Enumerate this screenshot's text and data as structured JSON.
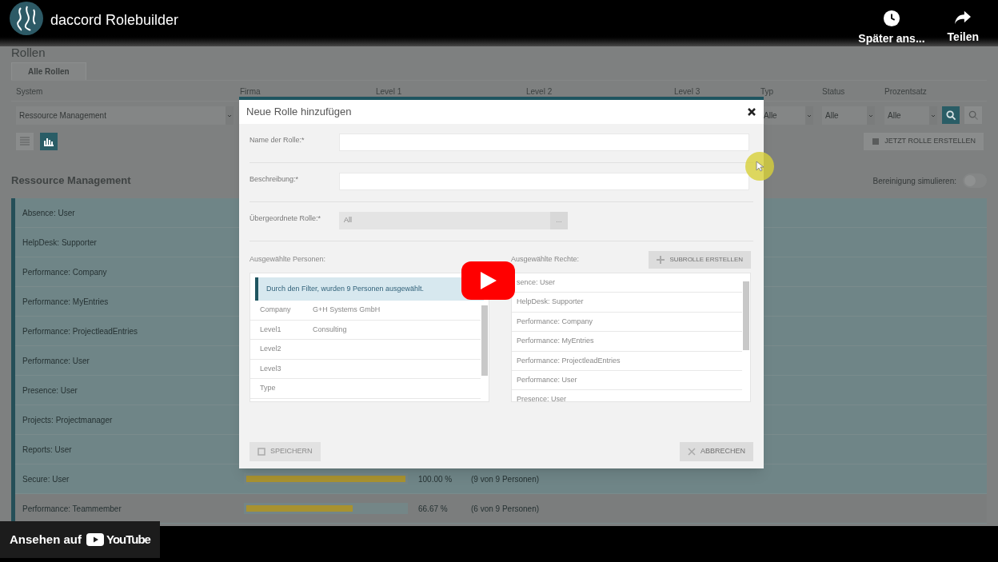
{
  "player": {
    "channel_title": "daccord Rolebuilder",
    "actions": [
      {
        "kind": "clock",
        "label": "Später ans..."
      },
      {
        "kind": "share",
        "label": "Teilen"
      }
    ],
    "watch_on": {
      "label": "Ansehen auf",
      "brand": "YouTube"
    }
  },
  "app": {
    "page_title": "Rollen",
    "tabs": [
      {
        "label": "Alle Rollen",
        "selected": true
      }
    ],
    "filters": [
      {
        "label": "System",
        "value": "Ressource Management"
      },
      {
        "label": "Firma"
      },
      {
        "label": "Level 1"
      },
      {
        "label": "Level 2"
      },
      {
        "label": "Level 3"
      },
      {
        "label": "Typ",
        "value": "Alle"
      },
      {
        "label": "Status",
        "value": "Alle"
      },
      {
        "label": "Prozentsatz",
        "value": "Alle"
      }
    ],
    "views": [
      {
        "kind": "list",
        "selected": false
      },
      {
        "kind": "chart",
        "selected": true
      }
    ],
    "create_button": "JETZT ROLLE ERSTELLEN",
    "section_title": "Ressource Management",
    "simulate": {
      "label": "Bereinigung simulieren:",
      "on": false
    },
    "roles": [
      {
        "name": "Absence: User",
        "highlighted": true
      },
      {
        "name": "HelpDesk: Supporter",
        "highlighted": true
      },
      {
        "name": "Performance: Company",
        "highlighted": true
      },
      {
        "name": "Performance: MyEntries",
        "highlighted": true
      },
      {
        "name": "Performance: ProjectleadEntries",
        "highlighted": true
      },
      {
        "name": "Performance: User",
        "highlighted": true
      },
      {
        "name": "Presence: User",
        "highlighted": true
      },
      {
        "name": "Projects: Projectmanager",
        "highlighted": true
      },
      {
        "name": "Reports: User",
        "highlighted": true
      },
      {
        "name": "Secure: User",
        "highlighted": true,
        "level": 1,
        "percent": "100.00 %",
        "count": "(9 von 9 Personen)"
      },
      {
        "name": "Performance: Teammember",
        "highlighted": false,
        "level": 0.6667,
        "percent": "66.67 %",
        "count": "(6 von 9 Personen)"
      }
    ]
  },
  "dialog": {
    "title": "Neue Rolle hinzufügen",
    "fields": [
      {
        "kind": "text",
        "label": "Name der Rolle:*"
      },
      {
        "kind": "text",
        "label": "Beschreibung:*"
      },
      {
        "kind": "select",
        "label": "Übergeordnete Rolle:*",
        "value": "All",
        "button": "..."
      }
    ],
    "persons": {
      "label": "Ausgewählte Personen:",
      "notice": "Durch den Filter, wurden 9 Personen ausgewählt.",
      "rows": [
        {
          "key": "Company",
          "value": "G+H Systems GmbH"
        },
        {
          "key": "Level1",
          "value": "Consulting"
        },
        {
          "key": "Level2"
        },
        {
          "key": "Level3"
        },
        {
          "key": "Type"
        }
      ]
    },
    "rights": {
      "label": "Ausgewählte Rechte:",
      "button": "SUBROLLE ERSTELLEN",
      "items": [
        "sence: User",
        "HelpDesk: Supporter",
        "Performance: Company",
        "Performance: MyEntries",
        "Performance: ProjectleadEntries",
        "Performance: User",
        "Presence: User"
      ]
    },
    "save_button": {
      "label": "SPEICHERN",
      "disabled": true
    },
    "cancel_button": {
      "label": "ABBRECHEN",
      "disabled": false
    }
  }
}
